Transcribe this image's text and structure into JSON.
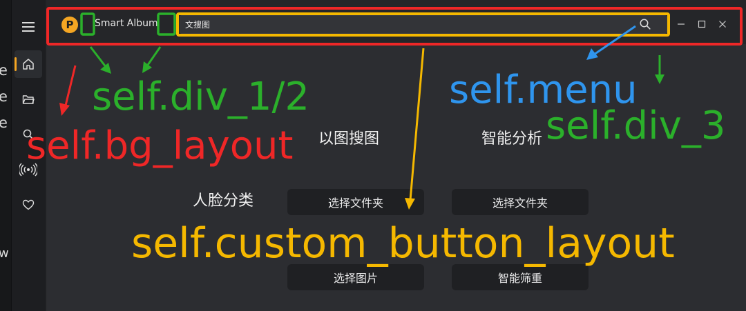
{
  "left_fragment": {
    "lines": [
      "e",
      "e",
      "e",
      "w"
    ]
  },
  "sidebar": {
    "items": [
      {
        "name": "menu",
        "icon": "hamburger-icon"
      },
      {
        "name": "home",
        "icon": "home-icon",
        "active": true
      },
      {
        "name": "folder",
        "icon": "folder-icon"
      },
      {
        "name": "search",
        "icon": "search-icon"
      },
      {
        "name": "signal",
        "icon": "broadcast-icon"
      },
      {
        "name": "favorites",
        "icon": "heart-icon"
      }
    ]
  },
  "titlebar": {
    "logo_letter": "P",
    "app_title": "Smart Album",
    "search_value": "文搜图",
    "window_controls": [
      "minimize-icon",
      "maximize-icon",
      "close-icon"
    ]
  },
  "content": {
    "image_search_heading": "以图搜图",
    "smart_analysis_heading": "智能分析",
    "face_heading": "人脸分类",
    "buttons": {
      "choose_folder_1": "选择文件夹",
      "choose_folder_2": "选择文件夹",
      "choose_image": "选择图片",
      "smart_dedupe": "智能筛重"
    }
  },
  "annotations": {
    "div_1_2": "self.div_1/2",
    "bg_layout": "self.bg_layout",
    "menu": "self.menu",
    "div_3": "self.div_3",
    "custom_button_layout": "self.custom_button_layout"
  },
  "colors": {
    "accent": "#f5a623",
    "annotation_red": "#ef2727",
    "annotation_green": "#2bb02b",
    "annotation_blue": "#2f95ee",
    "annotation_yellow": "#f5b800"
  }
}
